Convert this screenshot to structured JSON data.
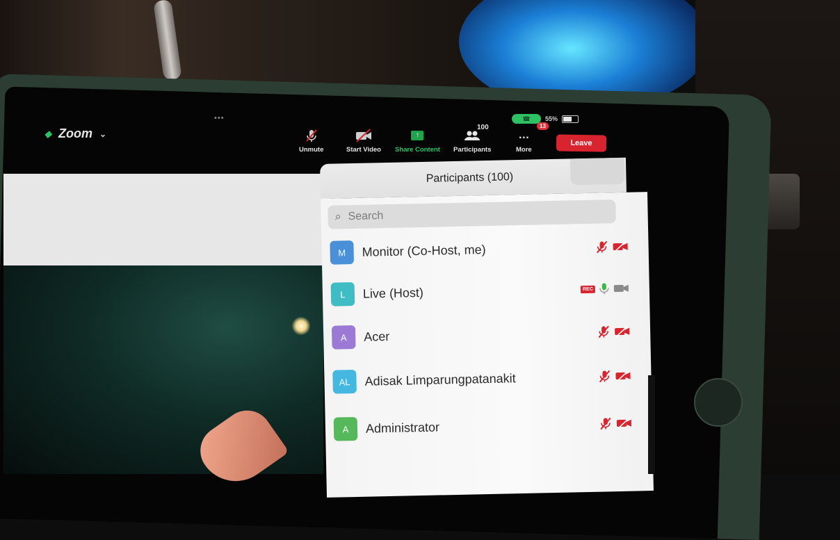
{
  "app": {
    "title": "Zoom",
    "multitask_dots": "•••"
  },
  "status_bar": {
    "status_text": "55%"
  },
  "toolbar": {
    "unmute_label": "Unmute",
    "start_video_label": "Start Video",
    "share_label": "Share Content",
    "participants_label": "Participants",
    "participants_count": "100",
    "more_label": "More",
    "more_badge": "13",
    "leave_label": "Leave"
  },
  "panel": {
    "title": "Participants (100)",
    "search_placeholder": "Search",
    "participants": [
      {
        "initials": "M",
        "name": "Monitor (Co-Host, me)",
        "color": "#4a90d9",
        "mic": "muted",
        "video": "off",
        "rec": false
      },
      {
        "initials": "L",
        "name": "Live (Host)",
        "color": "#3fbcc4",
        "mic": "on",
        "video": "on",
        "rec": true,
        "rec_label": "REC"
      },
      {
        "initials": "A",
        "name": "Acer",
        "color": "#9b7ad6",
        "mic": "muted",
        "video": "off",
        "rec": false
      },
      {
        "initials": "AL",
        "name": "Adisak Limparungpatanakit",
        "color": "#44b8e0",
        "mic": "muted",
        "video": "off",
        "rec": false
      },
      {
        "initials": "A",
        "name": "Administrator",
        "color": "#55b85a",
        "mic": "muted",
        "video": "off",
        "rec": false
      }
    ]
  },
  "colors": {
    "zoom_green": "#2ec163",
    "leave_red": "#d8242e",
    "muted_red": "#d8242e",
    "mic_on_green": "#3db548"
  }
}
